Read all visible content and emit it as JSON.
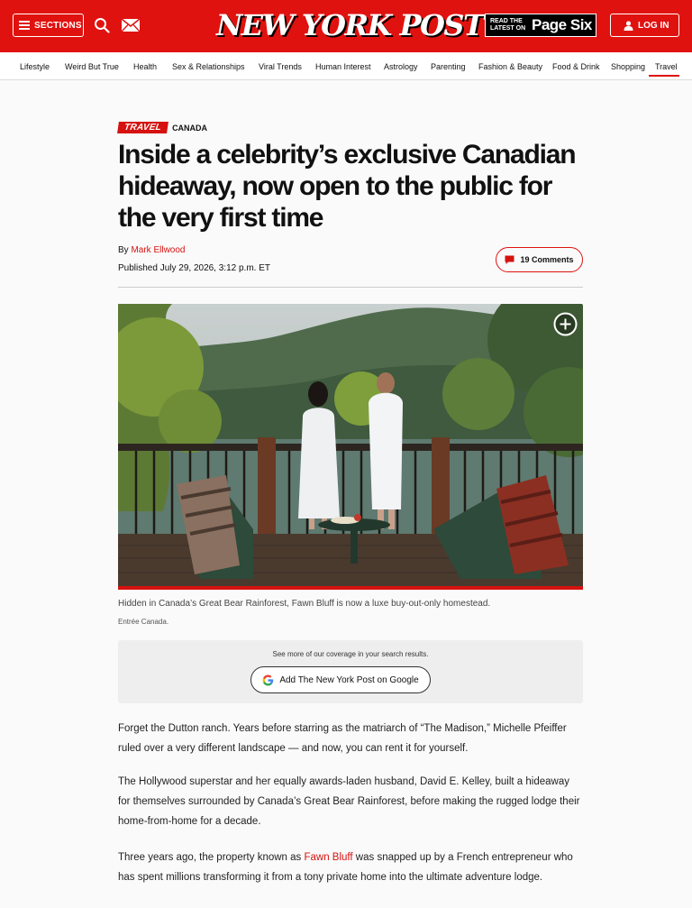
{
  "header": {
    "sections_label": "SECTIONS",
    "logo_text": "NEW YORK POST",
    "pagesix_small": "READ THE LATEST ON",
    "pagesix_big": "Page Six",
    "login_label": "LOG IN"
  },
  "nav": {
    "items": [
      {
        "label": "Lifestyle"
      },
      {
        "label": "Weird But True"
      },
      {
        "label": "Health"
      },
      {
        "label": "Sex & Relationships"
      },
      {
        "label": "Viral Trends"
      },
      {
        "label": "Human Interest"
      },
      {
        "label": "Astrology"
      },
      {
        "label": "Parenting"
      },
      {
        "label": "Fashion & Beauty"
      },
      {
        "label": "Food & Drink"
      },
      {
        "label": "Shopping"
      },
      {
        "label": "Travel"
      }
    ],
    "active": "Travel"
  },
  "article": {
    "kicker_tag": "TRAVEL",
    "kicker_sub": "CANADA",
    "headline": "Inside a celebrity’s exclusive Canadian hideaway, now open to the public for the very first time",
    "by_prefix": "By ",
    "author": "Mark Ellwood",
    "published": "Published July 29, 2026, 3:12 p.m. ET",
    "comments_label": "19 Comments",
    "image_caption": "Hidden in Canada’s Great Bear Rainforest, Fawn Bluff is now a luxe buy-out-only homestead.",
    "image_credit": "Entrée Canada.",
    "google_note": "See more of our coverage in your search results.",
    "google_button": "Add The New York Post on Google",
    "paragraphs": {
      "p1": "Forget the Dutton ranch. Years before starring as the matriarch of “The Madison,” Michelle Pfeiffer ruled over a very different landscape — and now, you can rent it for yourself.",
      "p2": "The Hollywood superstar and her equally awards-laden husband, David E. Kelley, built a hideaway for themselves surrounded by Canada’s Great Bear Rainforest, before making the rugged lodge their home-from-home for a decade.",
      "p3_before": "Three years ago, the property known as ",
      "p3_link": "Fawn Bluff",
      "p3_after": " was snapped up by a French entrepreneur who has spent millions transforming it from a tony private home into the ultimate adventure lodge."
    }
  },
  "colors": {
    "brand_red": "#e0120f",
    "link_red": "#d5120f"
  },
  "icons": [
    "hamburger-icon",
    "search-icon",
    "mail-icon",
    "user-icon",
    "comment-icon",
    "expand-icon",
    "google-g-icon"
  ]
}
